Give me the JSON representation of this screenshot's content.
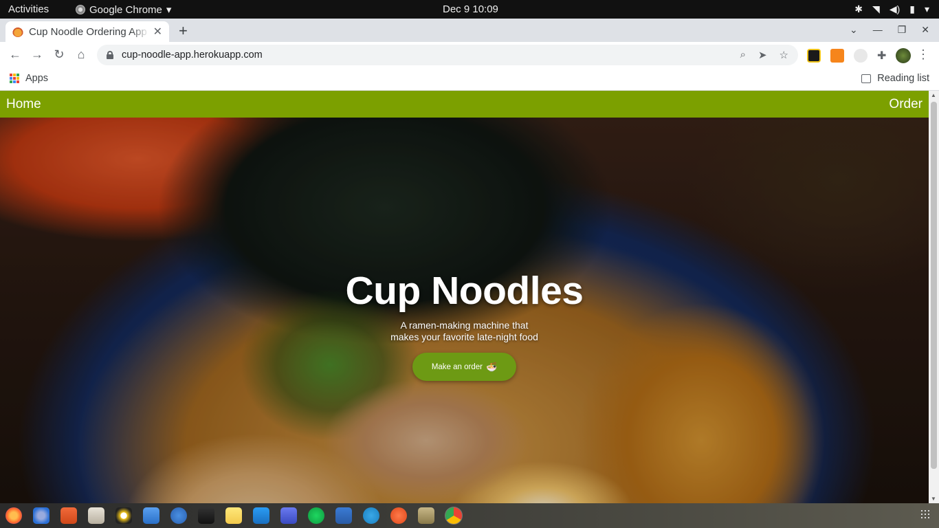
{
  "system": {
    "activities": "Activities",
    "app_name": "Google Chrome",
    "clock": "Dec 9  10:09"
  },
  "browser": {
    "tab_title": "Cup Noodle Ordering App",
    "url": "cup-noodle-app.herokuapp.com",
    "bookmarks_apps": "Apps",
    "reading_list": "Reading list"
  },
  "site": {
    "nav_home": "Home",
    "nav_order": "Order",
    "hero_title": "Cup Noodles",
    "hero_sub_line1": "A ramen-making machine that",
    "hero_sub_line2": "makes your favorite late-night food",
    "cta_label": "Make an order",
    "cta_emoji": "🍜"
  },
  "colors": {
    "nav_green": "#7ca000",
    "cta_green": "#6d9a14"
  },
  "dock": {
    "items": [
      "firefox-icon",
      "thunderbird-icon",
      "software-center-icon",
      "files-icon",
      "rhythmbox-icon",
      "document-viewer-icon",
      "help-icon",
      "terminal-icon",
      "notes-icon",
      "vscode-icon",
      "screenshot-icon",
      "spotify-icon",
      "bluetooth-icon",
      "telegram-icon",
      "compass-icon",
      "image-viewer-icon",
      "chrome-icon"
    ]
  }
}
